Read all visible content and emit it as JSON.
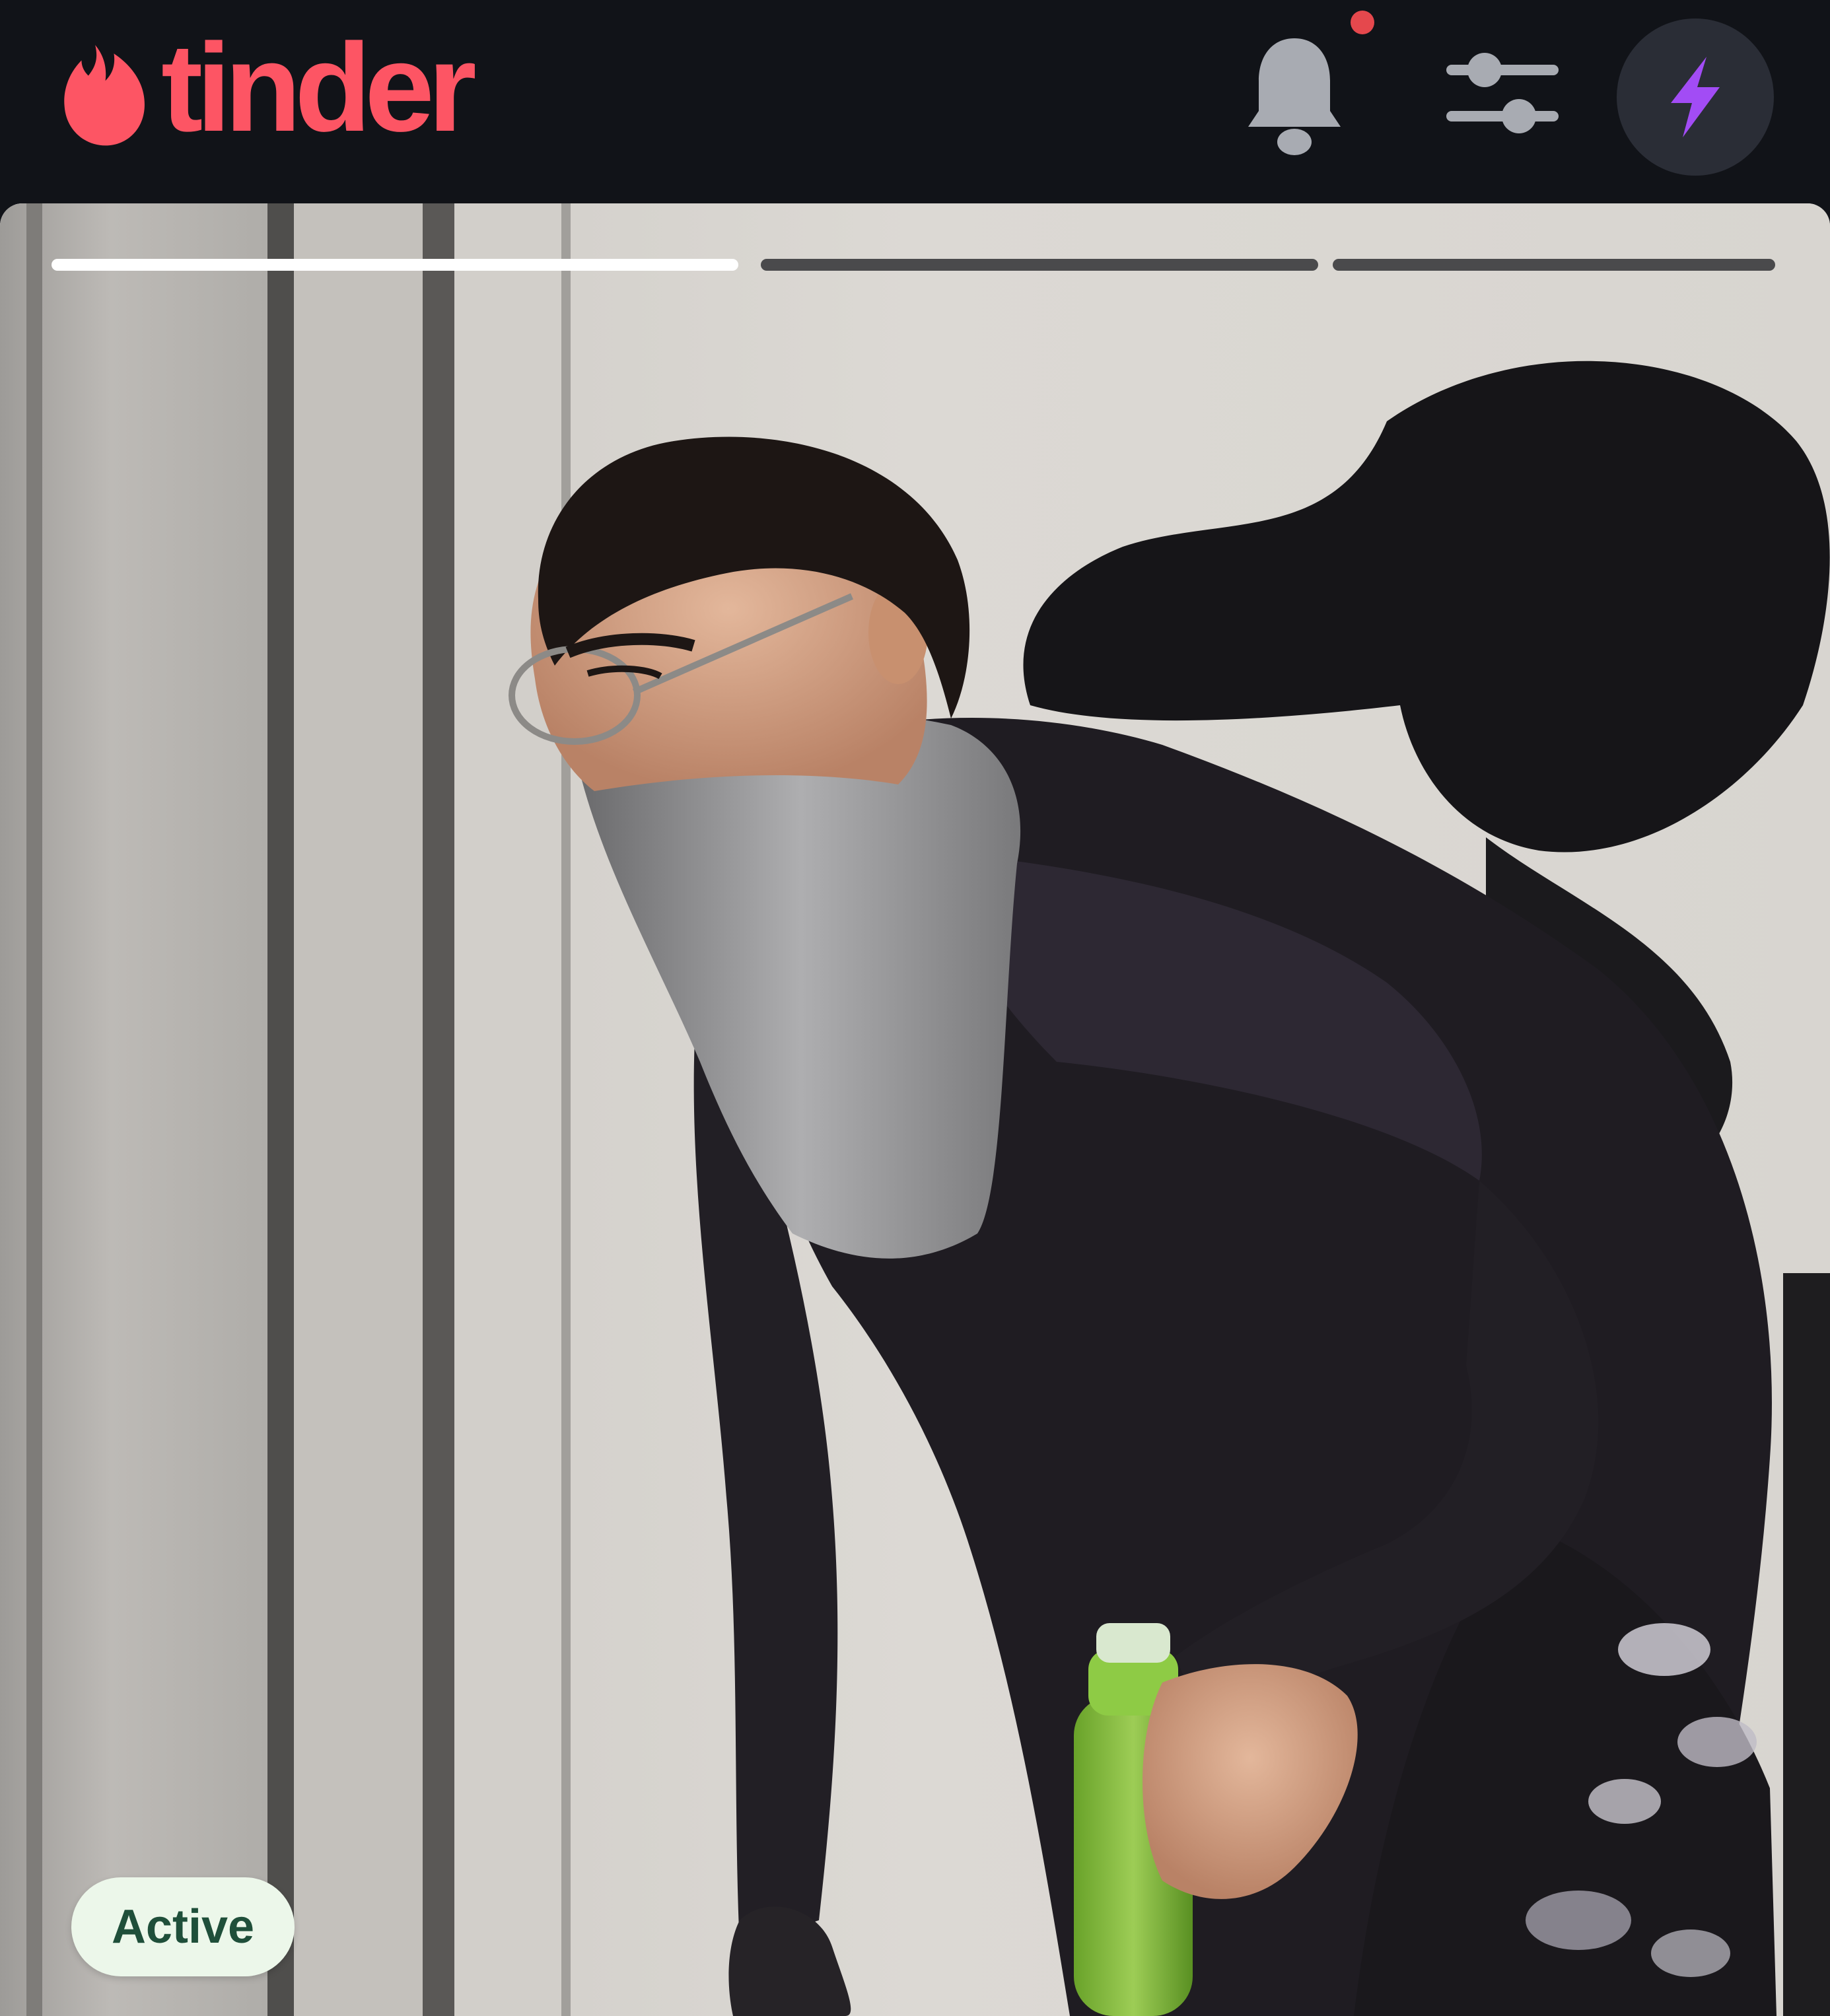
{
  "app": {
    "brand_name": "tinder",
    "brand_color": "#fd5564",
    "logo_icon": "flame-icon"
  },
  "header": {
    "notifications_icon": "bell-icon",
    "has_unread_notification": true,
    "filter_icon": "sliders-icon",
    "boost_icon": "lightning-bolt-icon",
    "boost_color": "#a24cf5"
  },
  "profile_card": {
    "photo_count": 3,
    "current_photo_index": 1,
    "photo_description_icon": "profile-photo",
    "status_badge": "Active",
    "status_badge_color": "#ecf7ea"
  }
}
